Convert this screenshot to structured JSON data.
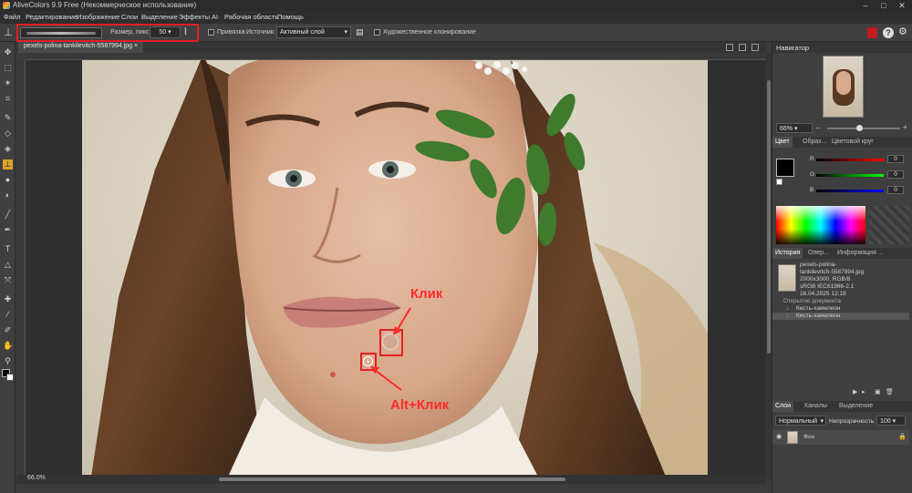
{
  "window": {
    "title": "AliveColors 9.9 Free (Некоммерческое использование)"
  },
  "menu": [
    "Файл",
    "Редактирование",
    "Изображение",
    "Слои",
    "Выделение",
    "Эффекты",
    "AI",
    "Рабочая область",
    "Помощь"
  ],
  "options": {
    "size_label": "Размер, пикс",
    "size_value": "50",
    "snap_label": "Привязка",
    "source_label": "Источник:",
    "source_value": "Активный слой",
    "artistic_label": "Художественное клонирование"
  },
  "document": {
    "tab_name": "pexels-polina-tankilevitch-5587994.jpg",
    "zoom_status": "66.0%"
  },
  "annotations": {
    "click": "Клик",
    "alt_click": "Alt+Клик"
  },
  "navigator": {
    "title": "Навигатор",
    "zoom": "66%"
  },
  "color_panel": {
    "tabs": [
      "Цвет",
      "Образ...",
      "Цветовой круг"
    ],
    "channels": [
      {
        "label": "R",
        "value": "0"
      },
      {
        "label": "G",
        "value": "0"
      },
      {
        "label": "B",
        "value": "0"
      }
    ]
  },
  "history": {
    "tabs": [
      "История",
      "Опер...",
      "Информация ..."
    ],
    "file_info": [
      "pexels-polina-",
      "tankilevitch-5587994.jpg",
      "2000x3000, RGB/8",
      "sRGB IEC61966-2.1",
      "16.04.2025 12:18"
    ],
    "items": [
      "Открытие документа",
      "Кисть-хамелеон",
      "Кисть-хамелеон"
    ]
  },
  "layers": {
    "tabs": [
      "Слои",
      "Каналы",
      "Выделение"
    ],
    "blend_mode": "Нормальный",
    "opacity_label": "Непрозрачность",
    "opacity_value": "100",
    "layer_name": "Фон"
  },
  "colors": {
    "accent_red": "#e21f26",
    "panel_bg": "#3f3f3f"
  }
}
